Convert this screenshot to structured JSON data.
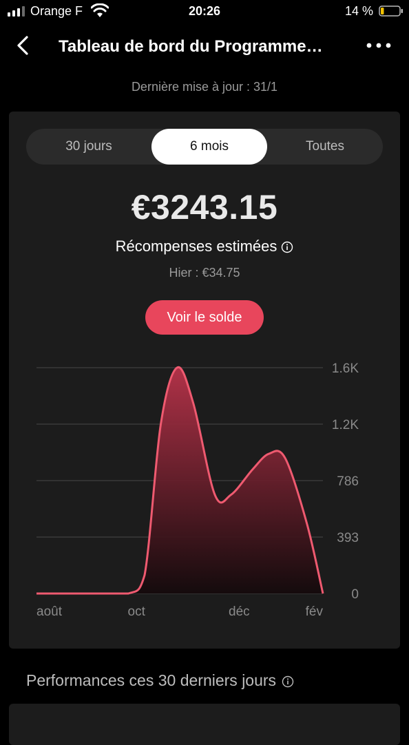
{
  "status_bar": {
    "carrier": "Orange F",
    "time": "20:26",
    "battery": "14 %",
    "battery_level": 0.14
  },
  "nav": {
    "title": "Tableau de bord du Programme…"
  },
  "last_update": "Dernière mise à jour : 31/1",
  "tabs": [
    {
      "label": "30 jours",
      "active": false
    },
    {
      "label": "6 mois",
      "active": true
    },
    {
      "label": "Toutes",
      "active": false
    }
  ],
  "summary": {
    "amount": "€3243.15",
    "label": "Récompenses estimées",
    "yesterday": "Hier : €34.75",
    "button": "Voir le solde"
  },
  "chart_data": {
    "type": "area",
    "x_labels": [
      "août",
      "oct",
      "déc",
      "fév"
    ],
    "y_ticks": [
      "1.6K",
      "1.2K",
      "786",
      "393",
      "0"
    ],
    "ylim": [
      0,
      1600
    ],
    "grid": true,
    "color": "#e8465c",
    "points": [
      {
        "x": 0.0,
        "y": 0
      },
      {
        "x": 1.0,
        "y": 0
      },
      {
        "x": 1.7,
        "y": 0
      },
      {
        "x": 2.0,
        "y": 130
      },
      {
        "x": 2.3,
        "y": 1200
      },
      {
        "x": 2.6,
        "y": 1600
      },
      {
        "x": 2.9,
        "y": 1350
      },
      {
        "x": 3.3,
        "y": 700
      },
      {
        "x": 3.6,
        "y": 700
      },
      {
        "x": 4.0,
        "y": 880
      },
      {
        "x": 4.3,
        "y": 990
      },
      {
        "x": 4.6,
        "y": 960
      },
      {
        "x": 5.0,
        "y": 500
      },
      {
        "x": 5.3,
        "y": 0
      }
    ]
  },
  "performance": {
    "title": "Performances ces 30 derniers jours"
  }
}
